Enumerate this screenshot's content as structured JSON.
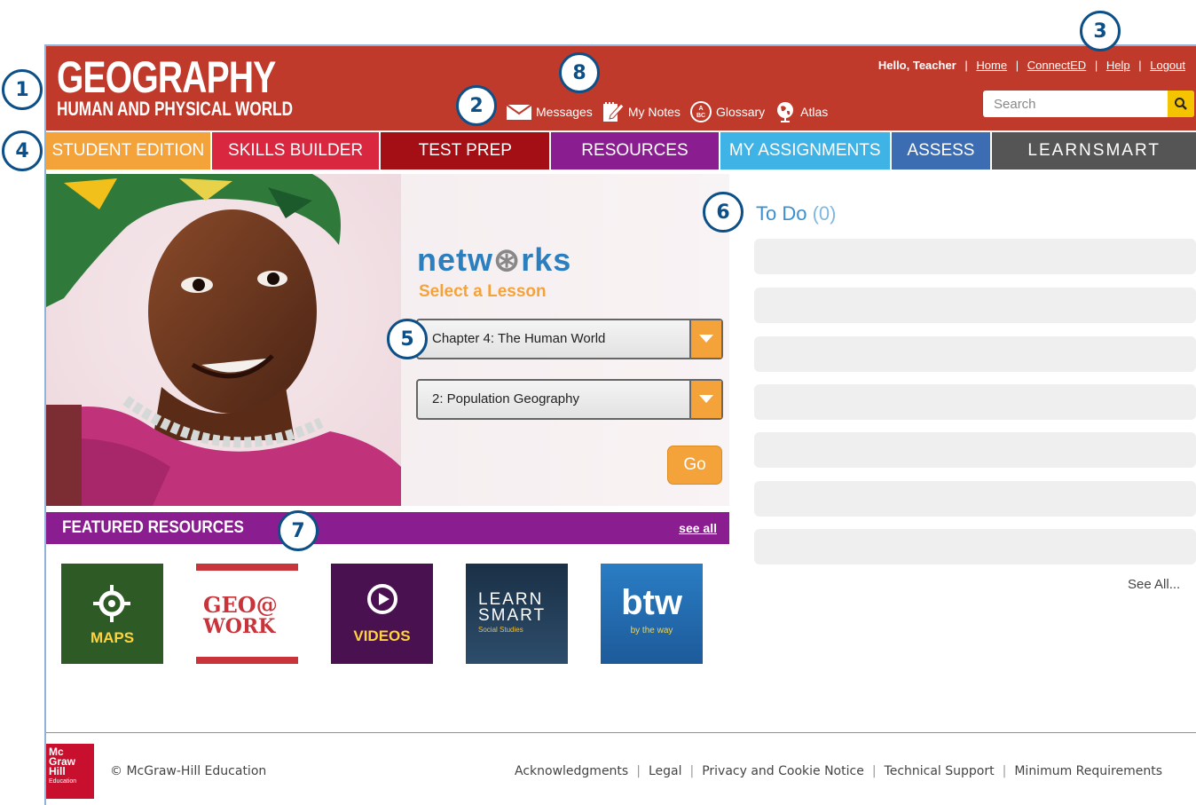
{
  "header": {
    "title": "GEOGRAPHY",
    "subtitle": "HUMAN AND PHYSICAL WORLD",
    "greeting": "Hello, Teacher",
    "links": {
      "home": "Home",
      "connected": "ConnectED",
      "help": "Help",
      "logout": "Logout"
    },
    "separator": "|",
    "search_placeholder": "Search",
    "quick_links": {
      "messages": "Messages",
      "notes": "My Notes",
      "glossary": "Glossary",
      "atlas": "Atlas"
    }
  },
  "nav": {
    "tabs": [
      "STUDENT EDITION",
      "SKILLS BUILDER",
      "TEST PREP",
      "RESOURCES",
      "MY ASSIGNMENTS",
      "ASSESS",
      "LEARNSMART"
    ]
  },
  "lesson": {
    "brand_a": "netw",
    "brand_o": "⊛",
    "brand_b": "rks",
    "label": "Select a Lesson",
    "chapter": "Chapter 4: The Human World",
    "lesson": "2: Population Geography",
    "go": "Go"
  },
  "featured": {
    "title": "FEATURED RESOURCES",
    "see_all": "see all",
    "tiles": {
      "maps": "MAPS",
      "geo_a": "GEO@",
      "geo_b": "WORK",
      "videos": "VIDEOS",
      "ls_a": "LEARN",
      "ls_b": "SMART",
      "ls_c": "Social Studies",
      "btw_a": "btw",
      "btw_b": "by the way"
    }
  },
  "todo": {
    "title": "To Do",
    "count": "(0)",
    "see_all": "See All..."
  },
  "footer": {
    "logo_a": "Mc",
    "logo_b": "Graw",
    "logo_c": "Hill",
    "logo_d": "Education",
    "copyright": "© McGraw-Hill Education",
    "links": [
      "Acknowledgments",
      "Legal",
      "Privacy and Cookie Notice",
      "Technical Support",
      "Minimum Requirements"
    ]
  },
  "callouts": [
    "1",
    "2",
    "3",
    "4",
    "5",
    "6",
    "7",
    "8"
  ],
  "colors": {
    "header": "#c03a2b",
    "student_edition": "#f4a33b",
    "skills_builder": "#d8273f",
    "test_prep": "#a30f14",
    "resources": "#8a1d8f",
    "my_assignments": "#40b3e6",
    "assess": "#3c6db2",
    "learnsmart": "#555555",
    "callout": "#0d4f87"
  }
}
